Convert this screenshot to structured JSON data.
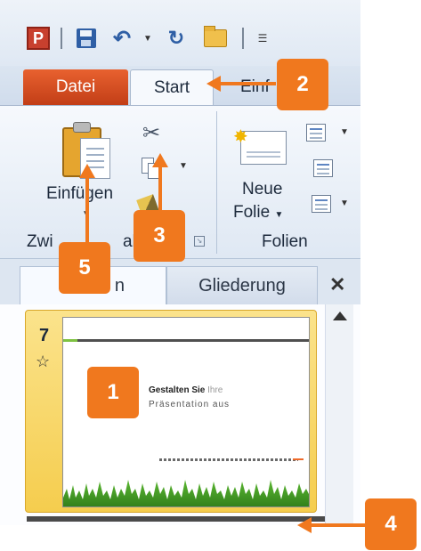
{
  "qat": {
    "app_icon": "P",
    "icons": [
      "powerpoint-logo-icon",
      "save-icon",
      "undo-icon",
      "redo-icon",
      "open-folder-icon",
      "customize-toolbar-icon"
    ]
  },
  "tabs": {
    "file_label": "Datei",
    "start_label": "Start",
    "insert_label": "Einf"
  },
  "ribbon": {
    "paste_label": "Einfügen",
    "clipboard_group_label": "Zwi",
    "clipboard_group_suffix": "ab",
    "new_slide_label_1": "Neue",
    "new_slide_label_2": "Folie",
    "slides_group_label": "Folien"
  },
  "pane": {
    "slides_tab_label": "n",
    "outline_tab_label": "Gliederung",
    "close_glyph": "✕"
  },
  "slide": {
    "number": "7",
    "title_bold": "Gestalten Sie",
    "title_light": "Ihre",
    "subtitle": "Präsentation aus"
  },
  "callouts": {
    "c1": "1",
    "c2": "2",
    "c3": "3",
    "c4": "4",
    "c5": "5"
  },
  "colors": {
    "callout": "#f0781e",
    "file_tab": "#d2491f",
    "selected_slide": "#f5cd4e"
  }
}
